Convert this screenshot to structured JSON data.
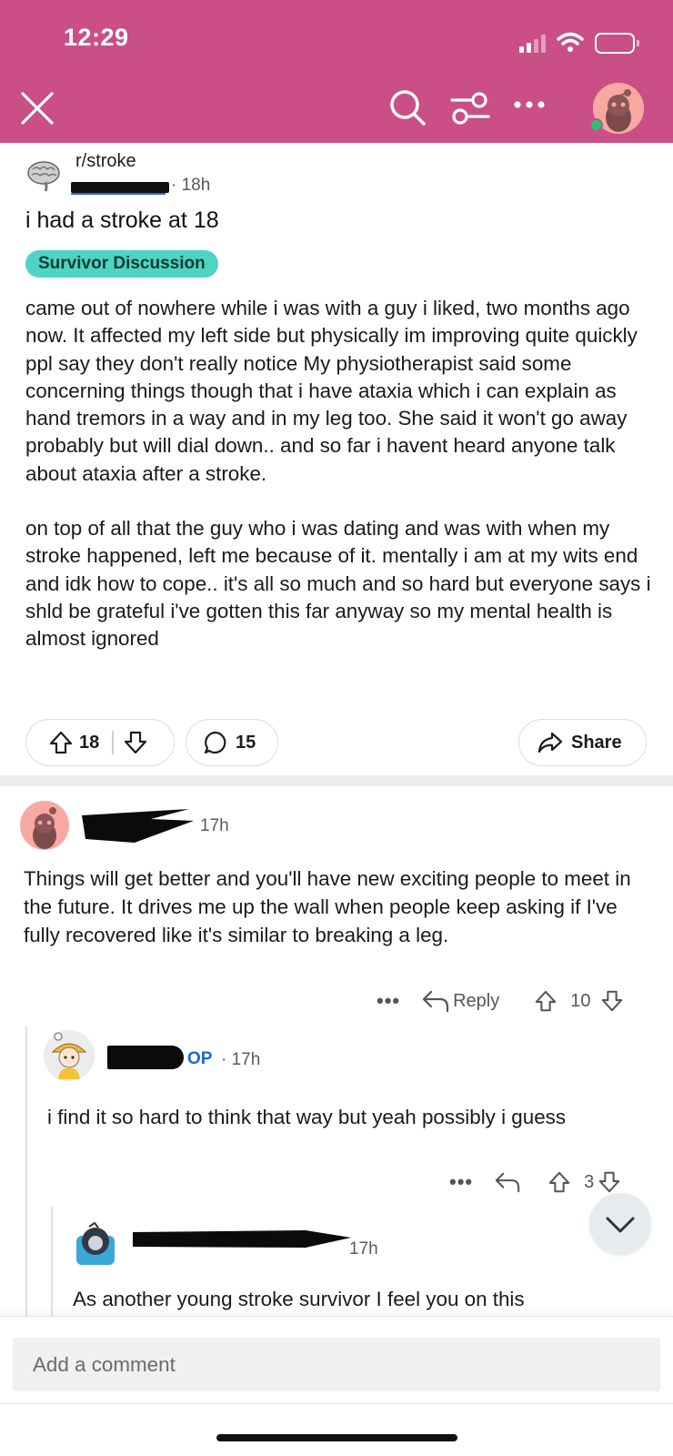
{
  "status_bar": {
    "time": "12:29"
  },
  "post": {
    "subreddit": "r/stroke",
    "age": "18h",
    "title": "i had a stroke at 18",
    "flair": "Survivor Discussion",
    "body": [
      "came out of nowhere while i was with a guy i liked, two months ago now. It affected my left side but physically im improving quite quickly ppl say they don't really notice My physiotherapist said some concerning things though that i have ataxia which i can explain as hand tremors in a way and in my leg too. She said it won't go away probably but will dial down.. and so far i havent heard anyone talk about ataxia after a stroke.",
      "on top of all that the guy who i was dating and was with when my stroke happened, left me because of it. mentally i am at my wits end and idk how to cope.. it's all so much and so hard but everyone says i shld be grateful i've gotten this far anyway so my mental health is almost ignored"
    ],
    "upvotes": "18",
    "comments": "15",
    "share_label": "Share"
  },
  "comments": [
    {
      "age": "17h",
      "body": "Things will get better and you'll have new exciting people to meet in the future. It drives me up the wall when people keep asking if I've fully recovered like it's similar to breaking a leg.",
      "reply_label": "Reply",
      "votes": "10",
      "more": "•••"
    },
    {
      "badge": "OP",
      "age": "· 17h",
      "body": "i find it so hard to think that way but yeah possibly i guess",
      "votes": "3",
      "more": "•••"
    },
    {
      "age": "17h",
      "body": "As another young stroke survivor I feel you on this"
    }
  ],
  "composer": {
    "placeholder": "Add a comment"
  },
  "colors": {
    "header": "#c94f86",
    "flair": "#4ed4c2",
    "op_badge": "#1a67d2",
    "online": "#27c46a"
  }
}
